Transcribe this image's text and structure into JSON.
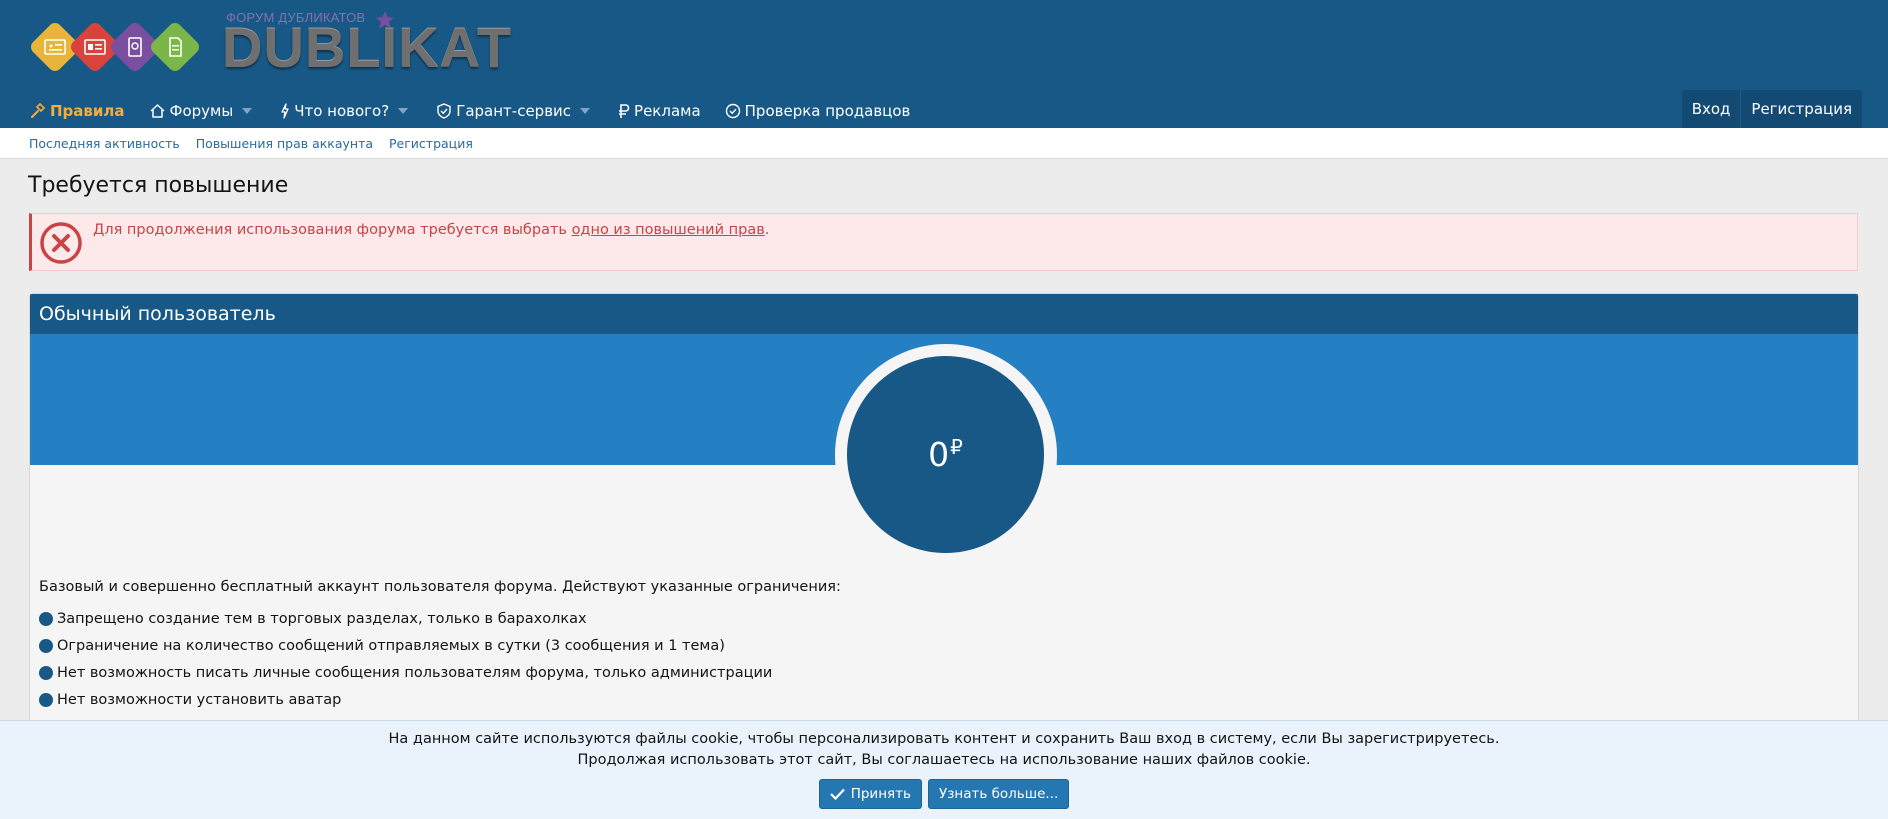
{
  "logo": {
    "tagline": "ФОРУМ ДУБЛИКАТОВ",
    "wordmark": "DUBLIKAT",
    "tile_colors": [
      "#e8b53a",
      "#d8443c",
      "#7a4fa0",
      "#7ab648"
    ]
  },
  "nav": {
    "items": [
      {
        "label": "Правила",
        "icon": "hammer-icon"
      },
      {
        "label": "Форумы",
        "icon": "home-icon",
        "dropdown": true
      },
      {
        "label": "Что нового?",
        "icon": "bolt-icon",
        "dropdown": true
      },
      {
        "label": "Гарант-сервис",
        "icon": "shield-check-icon",
        "dropdown": true
      },
      {
        "label": "Реклама",
        "icon": "ruble-icon"
      },
      {
        "label": "Проверка продавцов",
        "icon": "check-circle-icon"
      }
    ],
    "login": "Вход",
    "register": "Регистрация"
  },
  "subnav": {
    "items": [
      "Последняя активность",
      "Повышения прав аккаунта",
      "Регистрация"
    ]
  },
  "page": {
    "title": "Требуется повышение"
  },
  "alert": {
    "text": "Для продолжения использования форума требуется выбрать ",
    "link": "одно из повышений прав",
    "end": "."
  },
  "upgrade": {
    "title": "Обычный пользователь",
    "price": "0",
    "currency": "₽",
    "description": "Базовый и совершенно бесплатный аккаунт пользователя форума. Действуют указанные ограничения:",
    "features": [
      "Запрещено создание тем в торговых разделах, только в барахолках",
      "Ограничение на количество сообщений отправляемых в сутки (3 сообщения и 1 тема)",
      "Нет возможность писать личные сообщения пользователям форума, только администрации",
      "Нет возможности установить аватар"
    ]
  },
  "cookie": {
    "line1": "На данном сайте используются файлы cookie, чтобы персонализировать контент и сохранить Ваш вход в систему, если Вы зарегистрируетесь.",
    "line2": "Продолжая использовать этот сайт, Вы соглашаетесь на использование наших файлов cookie.",
    "accept": "Принять",
    "learn_more": "Узнать больше..."
  },
  "colors": {
    "header": "#185886",
    "accent_nav": "#f8ac38",
    "band": "#2580c3",
    "error": "#c84448"
  }
}
